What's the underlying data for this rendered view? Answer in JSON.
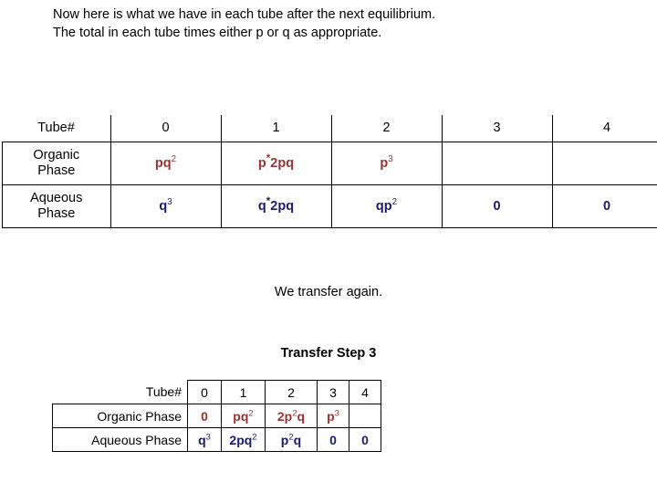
{
  "intro": {
    "line1": "Now here is what we have in each tube after the next equilibrium.",
    "line2": "The total in each tube times either p or q as appropriate."
  },
  "main_table": {
    "row_label_header": "Tube#",
    "columns": [
      "0",
      "1",
      "2",
      "3",
      "4"
    ],
    "rows": [
      {
        "label_line1": "Organic",
        "label_line2": "Phase",
        "color": "#993333",
        "cells": [
          "pq2",
          "p*2pq",
          "p3",
          "",
          ""
        ]
      },
      {
        "label_line1": "Aqueous",
        "label_line2": "Phase",
        "color": "#1a1a6e",
        "cells": [
          "q3",
          "q*2pq",
          "qp2",
          "0",
          "0"
        ]
      }
    ]
  },
  "caption_transfer": "We transfer again.",
  "caption_step": "Transfer Step 3",
  "summary_table": {
    "row_label_header": "Tube#",
    "columns": [
      "0",
      "1",
      "2",
      "3",
      "4"
    ],
    "rows": [
      {
        "label": "Organic Phase",
        "color": "#993333",
        "cells": [
          "0",
          "pq2",
          "2p2q",
          "p3",
          ""
        ]
      },
      {
        "label": "Aqueous Phase",
        "color": "#1a1a6e",
        "cells": [
          "q3",
          "2pq2",
          "p2q",
          "0",
          "0"
        ]
      }
    ]
  },
  "colors": {
    "organic": "#993333",
    "aqueous": "#1a1a6e",
    "text": "#000000",
    "background": "#ffffff",
    "border": "#000000"
  }
}
